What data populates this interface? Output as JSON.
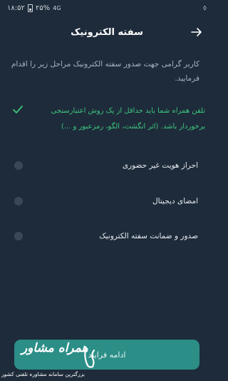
{
  "status_bar": {
    "time": "۱۸:۵۲",
    "battery": "۲۵%",
    "network_icon": "4g-icon",
    "signal_indicator": "⬨"
  },
  "header": {
    "title": "سفته الکترونیک",
    "back_icon": "arrow-right-icon"
  },
  "intro_text": "کاربر گرامی جهت صدور سفته الکترونیک مراحل زیر را اقدام فرمایید.",
  "requirement": {
    "icon": "check-icon",
    "text": "تلفن همراه شما باید حداقل از یک روش اعتبارسنجی برخوردار باشد. (اثر انگشت، الگو، رمزعبور و ...)"
  },
  "options": [
    {
      "label": "احراز هویت غیر حضوری"
    },
    {
      "label": "امضای دیجیتال"
    },
    {
      "label": "صدور و ضمانت سفته الکترونیک"
    }
  ],
  "continue_button": {
    "label": "ادامه فرایند"
  },
  "watermark": {
    "name": "همراه مشاور",
    "tagline": "بزرگترین سامانه مشاوره تلفنی کشور"
  },
  "colors": {
    "background": "#1e2b3a",
    "accent_green": "#3ec77f",
    "button_teal": "#2b8e87",
    "radio_gray": "#3a4756"
  }
}
